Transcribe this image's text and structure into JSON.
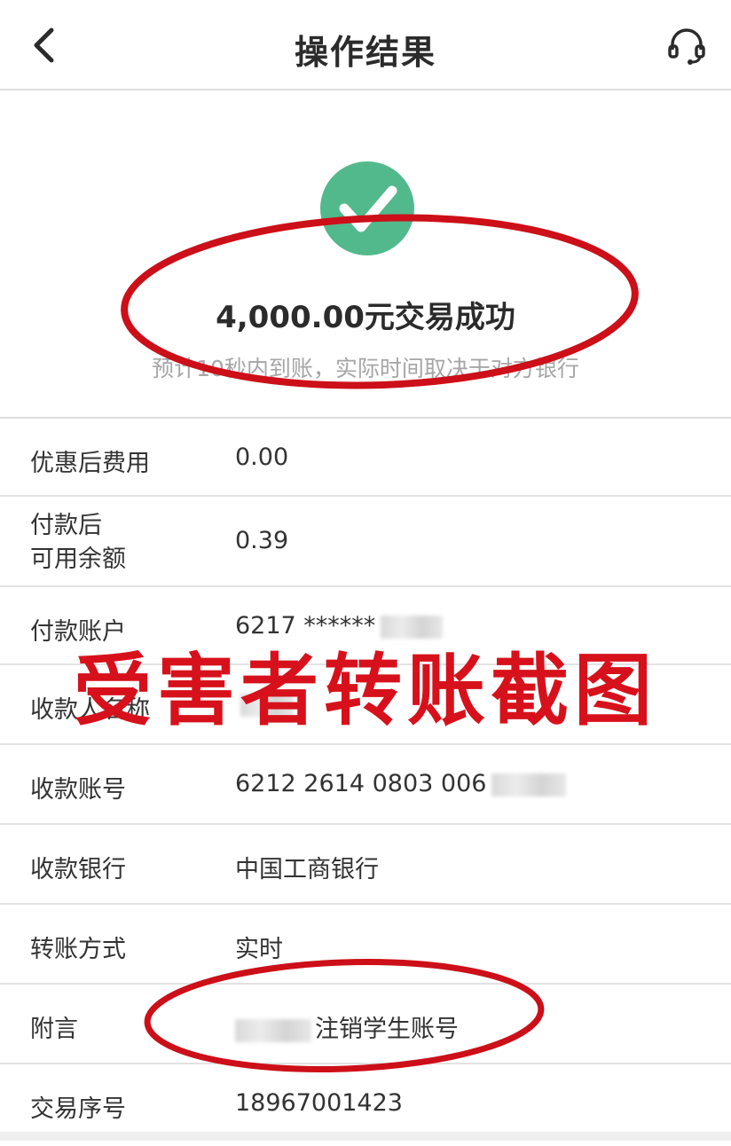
{
  "navbar": {
    "title": "操作结果",
    "back_icon": "chevron-left-icon",
    "service_icon": "headset-icon"
  },
  "result": {
    "status_icon": "checkmark-circle-icon",
    "amount_text": "4,000.00元交易成功",
    "subtitle": "预计10秒内到账，实际时间取决于对方银行"
  },
  "details": [
    {
      "key": "fee",
      "label": "优惠后费用",
      "value": "0.00"
    },
    {
      "key": "balance",
      "label": "付款后\n可用余额",
      "value": "0.39"
    },
    {
      "key": "payer_account",
      "label": "付款账户",
      "value": "6217 ******"
    },
    {
      "key": "payee_name",
      "label": "收款人名称",
      "value": ""
    },
    {
      "key": "payee_account",
      "label": "收款账号",
      "value": "6212 2614 0803 006"
    },
    {
      "key": "payee_bank",
      "label": "收款银行",
      "value": "中国工商银行"
    },
    {
      "key": "transfer_mode",
      "label": "转账方式",
      "value": "实时"
    },
    {
      "key": "remark",
      "label": "附言",
      "value": "注销学生账号"
    },
    {
      "key": "serial",
      "label": "交易序号",
      "value": "18967001423"
    }
  ],
  "overlay": {
    "watermark_text": "受害者转账截图",
    "color": "#d7111b"
  },
  "colors": {
    "success_green": "#52b98d",
    "divider": "#dedede",
    "subtitle_gray": "#a6a6a6"
  }
}
